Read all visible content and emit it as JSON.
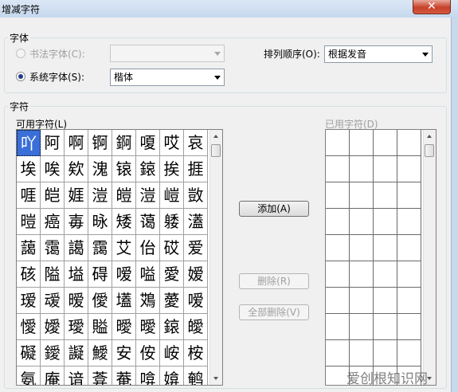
{
  "window": {
    "title": "增减字符",
    "close_glyph": "✕"
  },
  "font_group": {
    "legend": "字体",
    "calligraphy_label": "书法字体(C):",
    "calligraphy_value": "",
    "system_label": "系统字体(S):",
    "system_value": "楷体",
    "sort_label": "排列顺序(O):",
    "sort_value": "根据发音"
  },
  "char_group": {
    "legend": "字符",
    "available_label": "可用字符(L)",
    "used_label": "已用字符(D)",
    "available_chars": [
      [
        "吖",
        "阿",
        "啊",
        "锕",
        "錒",
        "嗄",
        "哎",
        "哀"
      ],
      [
        "埃",
        "唉",
        "欸",
        "溾",
        "锿",
        "鎄",
        "挨",
        "捱"
      ],
      [
        "啀",
        "皑",
        "娾",
        "溰",
        "皚",
        "溰",
        "嵦",
        "敳"
      ],
      [
        "暟",
        "癌",
        "毐",
        "昹",
        "矮",
        "蔼",
        "躷",
        "濭"
      ],
      [
        "藹",
        "霭",
        "譪",
        "靄",
        "艾",
        "佁",
        "砹",
        "爱"
      ],
      [
        "硋",
        "隘",
        "塧",
        "碍",
        "嗳",
        "嗌",
        "愛",
        "嫒"
      ],
      [
        "瑷",
        "叆",
        "暧",
        "僾",
        "壒",
        "鴱",
        "薆",
        "嗳"
      ],
      [
        "懓",
        "嬡",
        "璦",
        "賹",
        "曖",
        "曖",
        "鎄",
        "皧"
      ],
      [
        "礙",
        "鑀",
        "譺",
        "鱫",
        "安",
        "侒",
        "峖",
        "桉"
      ],
      [
        "氨",
        "庵",
        "谙",
        "葊",
        "菴",
        "啽",
        "媕",
        "鹌"
      ]
    ]
  },
  "buttons": {
    "add": "添加(A)",
    "delete": "删除(R)",
    "delete_all": "全部删除(V)"
  },
  "watermark": "爱创根知识网"
}
